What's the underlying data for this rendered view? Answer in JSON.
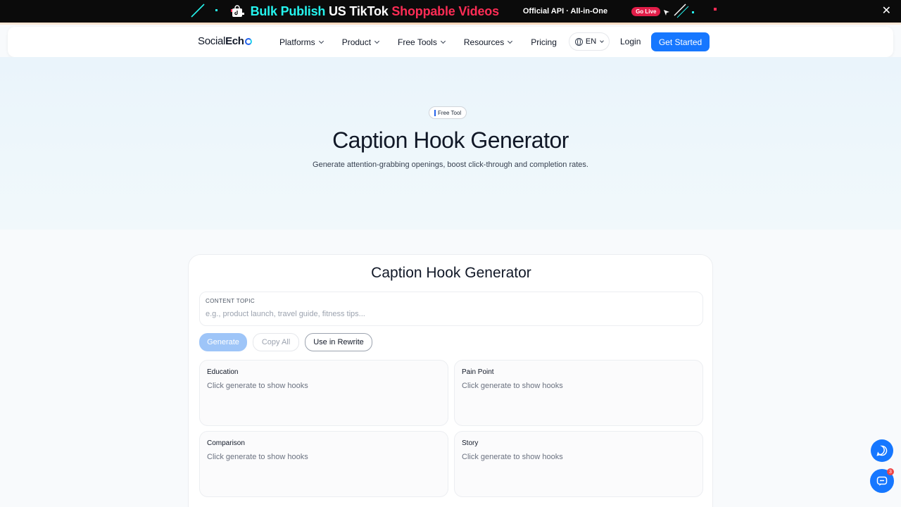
{
  "promo": {
    "part1": "Bulk Publish",
    "part2": "US TikTok",
    "part3": "Shoppable Videos",
    "subtitle": "Official API · All-in-One",
    "live_badge": "Go Live",
    "close": "✕",
    "colors": {
      "cyan": "#25f4ee",
      "pink": "#fe2c55"
    }
  },
  "nav": {
    "logo_light": "Social",
    "logo_bold": "Ech",
    "links": [
      "Platforms",
      "Product",
      "Free Tools",
      "Resources",
      "Pricing"
    ],
    "language": "EN",
    "login": "Login",
    "cta": "Get Started",
    "accent": "#1677ff"
  },
  "hero": {
    "badge": "Free Tool",
    "title": "Caption Hook Generator",
    "subtitle": "Generate attention-grabbing openings, boost click-through and completion rates."
  },
  "tool": {
    "title": "Caption Hook Generator",
    "field_label": "CONTENT TOPIC",
    "field_value": "",
    "field_placeholder": "e.g., product launch, travel guide, fitness tips...",
    "buttons": {
      "generate": "Generate",
      "copy_all": "Copy All",
      "use_in_rewrite": "Use in Rewrite"
    },
    "hooks": [
      {
        "title": "Education",
        "body": "Click generate to show hooks"
      },
      {
        "title": "Pain Point",
        "body": "Click generate to show hooks"
      },
      {
        "title": "Comparison",
        "body": "Click generate to show hooks"
      },
      {
        "title": "Story",
        "body": "Click generate to show hooks"
      }
    ]
  },
  "widgets": {
    "chat_icon": "chat-bubble-icon",
    "support_icon": "message-icon",
    "unread_count": "3"
  }
}
